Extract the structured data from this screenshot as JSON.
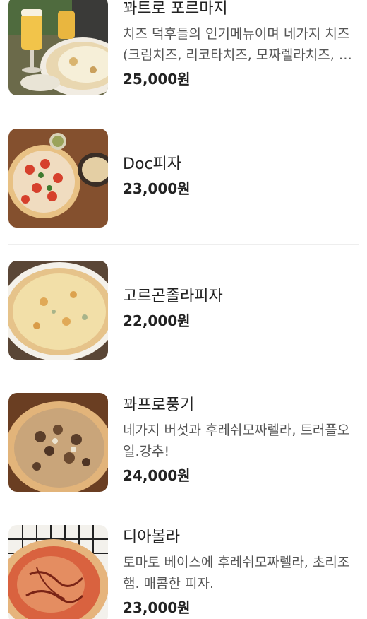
{
  "menu": {
    "items": [
      {
        "name": "꽈트로 포르마지",
        "description": "치즈 덕후들의 인기메뉴이며 네가지 치즈(크림치즈, 리코타치즈, 모짜렐라치즈, 고르곤졸라치즈)",
        "price": "25,000원",
        "image_icon": "pizza-beer-photo"
      },
      {
        "name": "Doc피자",
        "description": "",
        "price": "23,000원",
        "image_icon": "margherita-pizza-photo"
      },
      {
        "name": "고르곤졸라피자",
        "description": "",
        "price": "22,000원",
        "image_icon": "gorgonzola-pizza-photo"
      },
      {
        "name": "꽈프로풍기",
        "description": "네가지 버섯과 후레쉬모짜렐라, 트러플오일.강추!",
        "price": "24,000원",
        "image_icon": "mushroom-pizza-photo"
      },
      {
        "name": "디아볼라",
        "description": "토마토 베이스에 후레쉬모짜렐라, 초리조햄. 매콤한 피자.",
        "price": "23,000원",
        "image_icon": "diavola-pizza-photo"
      }
    ]
  }
}
